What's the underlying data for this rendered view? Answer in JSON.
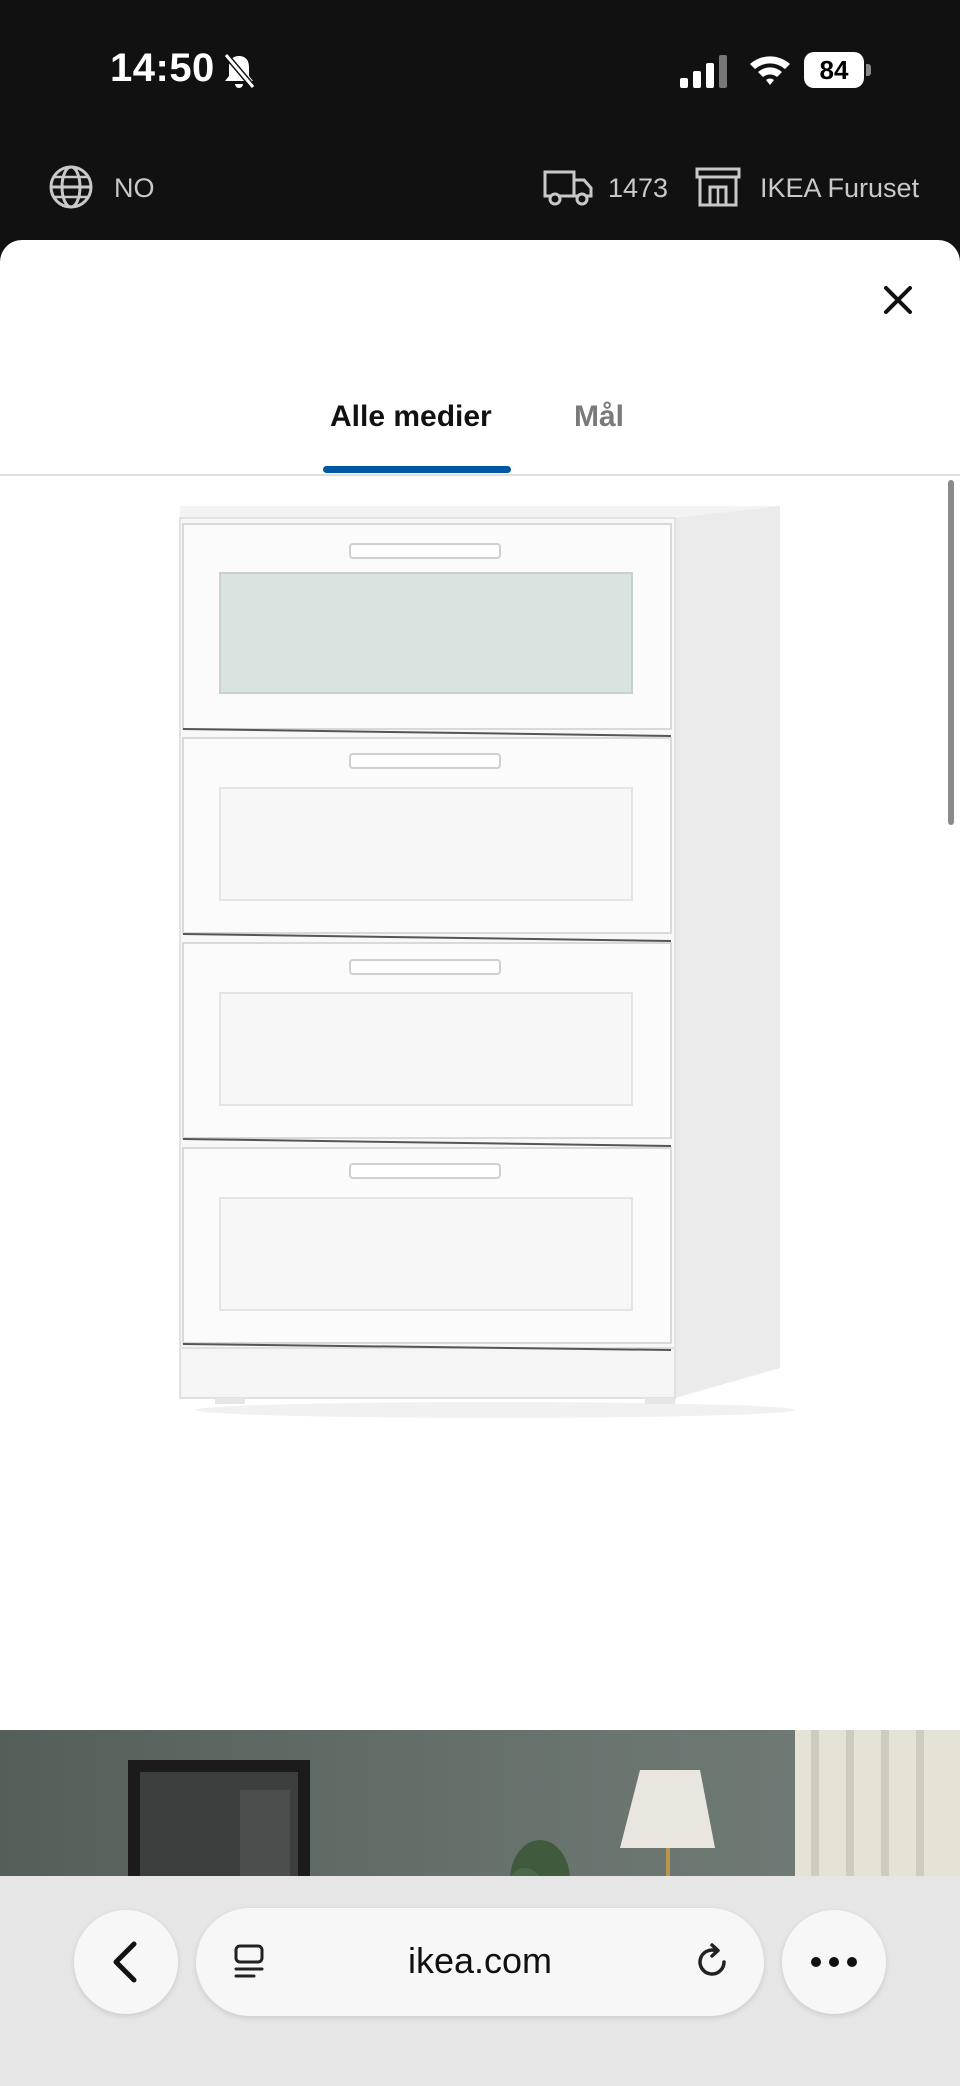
{
  "status_bar": {
    "time": "14:50",
    "battery": "84",
    "icons": [
      "bell-slash-icon",
      "cellular-signal-icon",
      "wifi-icon",
      "battery-icon"
    ]
  },
  "ikea_header": {
    "language": "NO",
    "postal_code": "1473",
    "store": "IKEA Furuset",
    "icons": [
      "globe-icon",
      "delivery-truck-icon",
      "store-icon"
    ]
  },
  "modal": {
    "close_icon": "close-icon",
    "tabs": [
      {
        "label": "Alle medier",
        "active": true
      },
      {
        "label": "Mål",
        "active": false
      }
    ],
    "accent_color": "#0058a3"
  },
  "browser": {
    "url": "ikea.com",
    "icons": [
      "chevron-left-icon",
      "tabs-icon",
      "reload-icon",
      "more-icon"
    ]
  }
}
